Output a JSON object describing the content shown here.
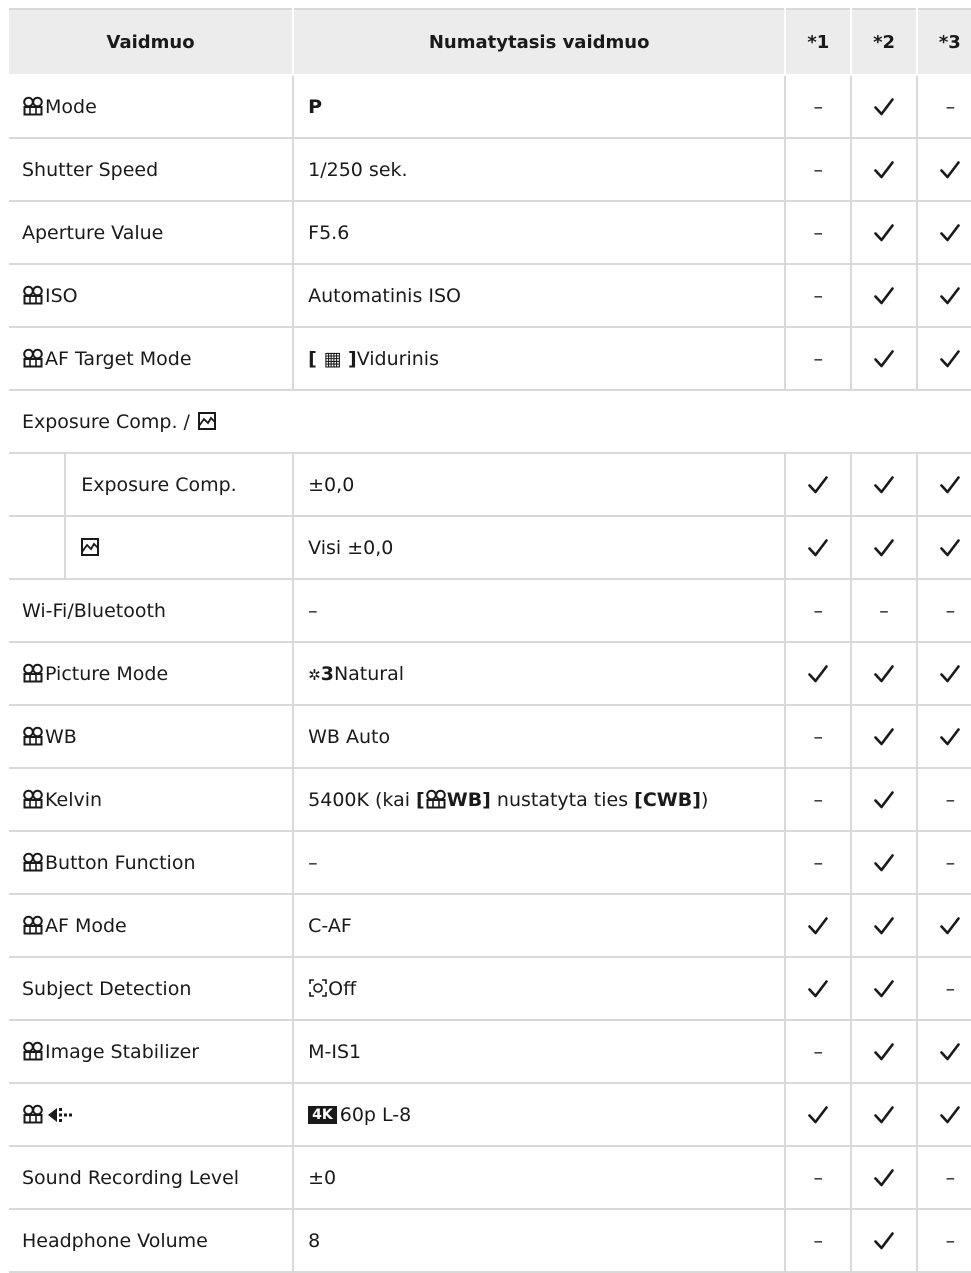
{
  "header": {
    "col_mode": "Vaidmuo",
    "col_default": "Numatytasis vaidmuo",
    "col_1": "*1",
    "col_2": "*2",
    "col_3": "*3"
  },
  "rows": [
    {
      "name": "Mode",
      "value": "P",
      "marks": [
        "–",
        "check",
        "–"
      ]
    },
    {
      "name": "Shutter Speed",
      "value": "1/250 sek.",
      "marks": [
        "–",
        "check",
        "check"
      ]
    },
    {
      "name": "Aperture Value",
      "value": "F5.6",
      "marks": [
        "–",
        "check",
        "check"
      ]
    },
    {
      "name": "ISO",
      "value": "Automatinis ISO",
      "marks": [
        "–",
        "check",
        "check"
      ]
    },
    {
      "name": "AF Target Mode",
      "value_prefix": "[ ▦ ]",
      "value": "Vidurinis",
      "marks": [
        "–",
        "check",
        "check"
      ]
    },
    {
      "name": "Exposure Comp. / "
    },
    {
      "name": "Exposure Comp.",
      "value": "±0,0",
      "marks": [
        "check",
        "check",
        "check"
      ]
    },
    {
      "name": "",
      "value": "Visi ±0,0",
      "marks": [
        "check",
        "check",
        "check"
      ]
    },
    {
      "name": "Wi-Fi/Bluetooth",
      "value": "–",
      "marks": [
        "–",
        "–",
        "–"
      ]
    },
    {
      "name": "Picture Mode",
      "value_prefix": "3",
      "value": "Natural",
      "marks": [
        "check",
        "check",
        "check"
      ]
    },
    {
      "name": "WB",
      "value": "WB Auto",
      "marks": [
        "–",
        "check",
        "check"
      ]
    },
    {
      "name": "Kelvin",
      "value_a": "5400K (kai ",
      "value_b": "[",
      "value_c": "WB]",
      "value_d": " nustatyta ties ",
      "value_e": "[CWB]",
      "value_f": ")",
      "marks": [
        "–",
        "check",
        "–"
      ]
    },
    {
      "name": "Button Function",
      "value": "–",
      "marks": [
        "–",
        "check",
        "–"
      ]
    },
    {
      "name": "AF Mode",
      "value": "C-AF",
      "marks": [
        "check",
        "check",
        "check"
      ]
    },
    {
      "name": "Subject Detection",
      "value": "Off",
      "marks": [
        "check",
        "check",
        "–"
      ]
    },
    {
      "name": "Image Stabilizer",
      "value": "M-IS1",
      "marks": [
        "–",
        "check",
        "check"
      ]
    },
    {
      "name": "",
      "value_prefix": "4K",
      "value": "60p L-8",
      "marks": [
        "check",
        "check",
        "check"
      ]
    },
    {
      "name": "Sound Recording Level",
      "value": "±0",
      "marks": [
        "–",
        "check",
        "–"
      ]
    },
    {
      "name": "Headphone Volume",
      "value": "8",
      "marks": [
        "–",
        "check",
        "–"
      ]
    }
  ]
}
